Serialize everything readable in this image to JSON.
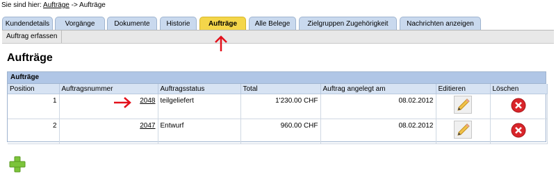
{
  "breadcrumb": {
    "prefix": "Sie sind hier:",
    "link": "Aufträge",
    "separator": "->",
    "current": "Aufträge"
  },
  "tabs": [
    {
      "label": "Kundendetails"
    },
    {
      "label": "Vorgänge"
    },
    {
      "label": "Dokumente"
    },
    {
      "label": "Historie"
    },
    {
      "label": "Aufträge",
      "active": true
    },
    {
      "label": "Alle Belege"
    },
    {
      "label": "Zielgruppen Zugehörigkeit"
    },
    {
      "label": "Nachrichten anzeigen"
    }
  ],
  "subbar": {
    "create_order": "Auftrag erfassen"
  },
  "page": {
    "title": "Aufträge"
  },
  "orders_panel": {
    "title": "Aufträge",
    "columns": [
      "Position",
      "Auftragsnummer",
      "Auftragsstatus",
      "Total",
      "Auftrag angelegt am",
      "Editieren",
      "Löschen"
    ],
    "rows": [
      {
        "position": "1",
        "order_number": "2048",
        "status": "teilgeliefert",
        "total": "1'230.00 CHF",
        "created": "08.02.2012"
      },
      {
        "position": "2",
        "order_number": "2047",
        "status": "Entwurf",
        "total": "960.00 CHF",
        "created": "08.02.2012"
      }
    ]
  },
  "icons": {
    "edit": "pencil-icon",
    "delete": "delete-x-icon",
    "add": "plus-icon",
    "annotation": "red-arrow-icon"
  },
  "colors": {
    "tab_active": "#f4d64a",
    "tab": "#c9d9ee",
    "panel_header": "#b0c6e6",
    "annotation": "#e3101b",
    "delete": "#d9252a",
    "add": "#7cc43a"
  }
}
